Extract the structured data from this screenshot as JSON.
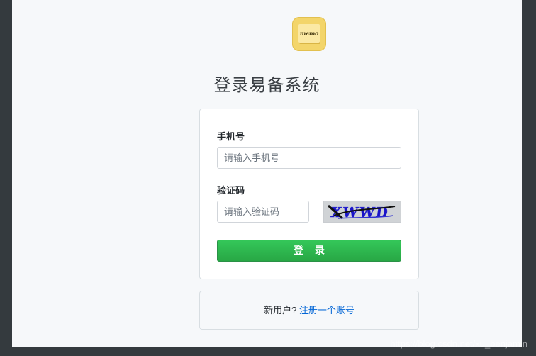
{
  "logo": {
    "text": "memo",
    "icon": "memo-note-icon",
    "color": "#f3d56a"
  },
  "title": "登录易备系统",
  "form": {
    "phone_label": "手机号",
    "phone_placeholder": "请输入手机号",
    "captcha_label": "验证码",
    "captcha_placeholder": "请输入验证码",
    "captcha_text": "XWWD",
    "login_button": "登 录"
  },
  "signup": {
    "prompt": "新用户? ",
    "link": "注册一个账号"
  },
  "watermark": "https://blog.csdn.net/xu_benjamin",
  "colors": {
    "primary_button": "#2ea44f",
    "link": "#0366d6",
    "background": "#f6f8fa",
    "frame": "#343a3e"
  }
}
